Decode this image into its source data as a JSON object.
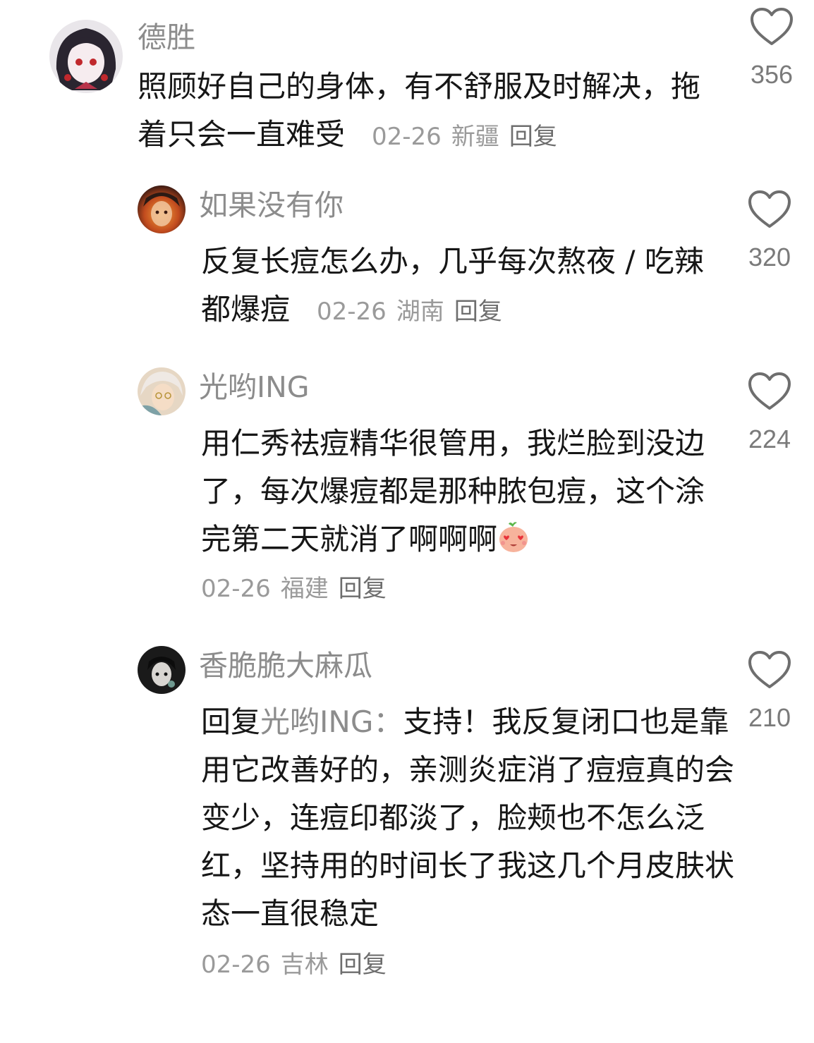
{
  "comments": [
    {
      "username": "德胜",
      "text": "照顾好自己的身体，有不舒服及时解决，拖着只会一直难受",
      "date": "02-26",
      "location": "新疆",
      "reply_label": "回复",
      "likes": "356"
    },
    {
      "username": "如果没有你",
      "text": "反复长痘怎么办，几乎每次熬夜 / 吃辣都爆痘",
      "date": "02-26",
      "location": "湖南",
      "reply_label": "回复",
      "likes": "320"
    },
    {
      "username": "光哟ING",
      "text": "用仁秀祛痘精华很管用，我烂脸到没边了，每次爆痘都是那种脓包痘，这个涂完第二天就消了啊啊啊",
      "emoji": "heart-eyes-face-emoji",
      "date": "02-26",
      "location": "福建",
      "reply_label": "回复",
      "likes": "224"
    },
    {
      "username": "香脆脆大麻瓜",
      "reply_prefix": "回复",
      "mention": "光哟ING",
      "mention_sep": "：",
      "text": "支持！我反复闭口也是靠用它改善好的，亲测炎症消了痘痘真的会变少，连痘印都淡了，脸颊也不怎么泛红，坚持用的时间长了我这几个月皮肤状态一直很稳定",
      "date": "02-26",
      "location": "吉林",
      "reply_label": "回复",
      "likes": "210"
    }
  ],
  "colors": {
    "text": "#161616",
    "username": "#8c8c8c",
    "meta": "#9a9a9a",
    "icon": "#6e6e6e"
  }
}
